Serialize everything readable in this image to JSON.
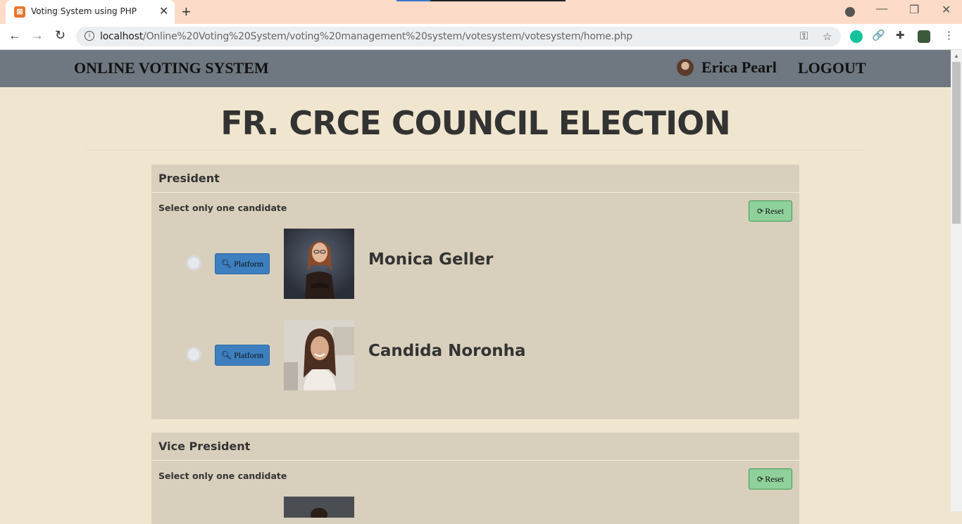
{
  "browser": {
    "tab_title": "Voting System using PHP",
    "url_host": "localhost",
    "url_path": "/Online%20Voting%20System/voting%20management%20system/votesystem/votesystem/home.php"
  },
  "nav": {
    "brand": "ONLINE VOTING SYSTEM",
    "user_name": "Erica Pearl",
    "logout": "LOGOUT"
  },
  "page": {
    "title": "FR. CRCE COUNCIL ELECTION"
  },
  "positions": [
    {
      "title": "President",
      "instruction": "Select only one candidate",
      "reset_label": "Reset",
      "candidates": [
        {
          "name": "Monica Geller",
          "platform_label": "Platform"
        },
        {
          "name": "Candida Noronha",
          "platform_label": "Platform"
        }
      ]
    },
    {
      "title": "Vice President",
      "instruction": "Select only one candidate",
      "reset_label": "Reset"
    }
  ]
}
